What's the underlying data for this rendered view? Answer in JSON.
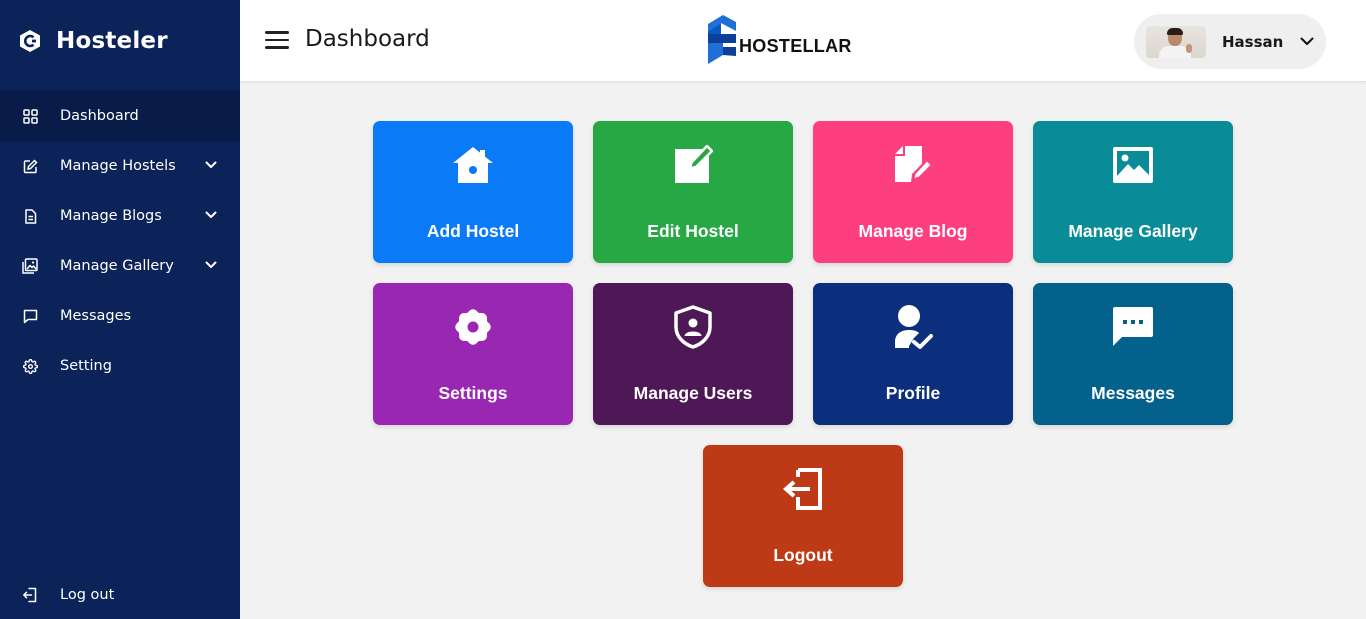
{
  "sidebar": {
    "brand": "Hosteler",
    "items": [
      {
        "label": "Dashboard",
        "icon": "grid-icon"
      },
      {
        "label": "Manage Hostels",
        "icon": "edit-icon"
      },
      {
        "label": "Manage Blogs",
        "icon": "document-icon"
      },
      {
        "label": "Manage Gallery",
        "icon": "gallery-icon"
      },
      {
        "label": "Messages",
        "icon": "chat-icon"
      },
      {
        "label": "Setting",
        "icon": "gear-icon"
      }
    ],
    "logout_label": "Log out",
    "bg_color": "#0b2358",
    "active_color": "#091c48"
  },
  "header": {
    "title": "Dashboard",
    "logo_text": "HOSTELLAR",
    "user": {
      "name": "Hassan"
    }
  },
  "tiles": [
    {
      "label": "Add Hostel",
      "color": "#0a7af7",
      "icon": "house-icon"
    },
    {
      "label": "Edit Hostel",
      "color": "#28a745",
      "icon": "edit-square-icon"
    },
    {
      "label": "Manage Blog",
      "color": "#fd3f80",
      "icon": "files-edit-icon"
    },
    {
      "label": "Manage Gallery",
      "color": "#0a8b98",
      "icon": "image-icon"
    },
    {
      "label": "Settings",
      "color": "#9a27b2",
      "icon": "gear-icon"
    },
    {
      "label": "Manage Users",
      "color": "#4e1856",
      "icon": "shield-user-icon"
    },
    {
      "label": "Profile",
      "color": "#0b2f7c",
      "icon": "user-check-icon"
    },
    {
      "label": "Messages",
      "color": "#03618c",
      "icon": "message-dots-icon"
    },
    {
      "label": "Logout",
      "color": "#be3a16",
      "icon": "logout-icon"
    }
  ]
}
